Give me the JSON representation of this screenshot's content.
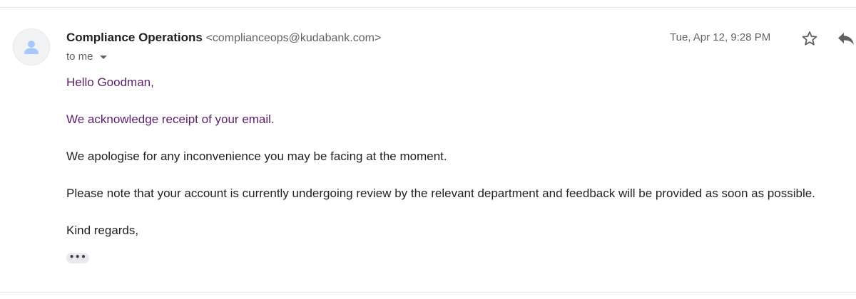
{
  "header": {
    "sender_name": "Compliance Operations",
    "sender_email": "<complianceops@kudabank.com>",
    "recipient_label": "to me",
    "timestamp": "Tue, Apr 12, 9:28 PM",
    "icons": {
      "avatar": "person-icon",
      "star": "star-outline-icon",
      "reply": "reply-icon",
      "recipient_dropdown": "caret-down-icon"
    }
  },
  "message": {
    "greeting": "Hello Goodman,",
    "paragraphs": [
      "We acknowledge receipt of your email.",
      "We apologise for any inconvenience you may be facing at the moment.",
      "Please note that your account is currently undergoing review by the relevant department and feedback will be provided as soon as possible."
    ],
    "closing": "Kind regards,",
    "trimmed_content_label": "•••"
  },
  "colors": {
    "purple_text": "#5b1e6a",
    "body_text": "#222222",
    "secondary_text": "#5f6368",
    "avatar_icon": "#a8c7fa"
  }
}
